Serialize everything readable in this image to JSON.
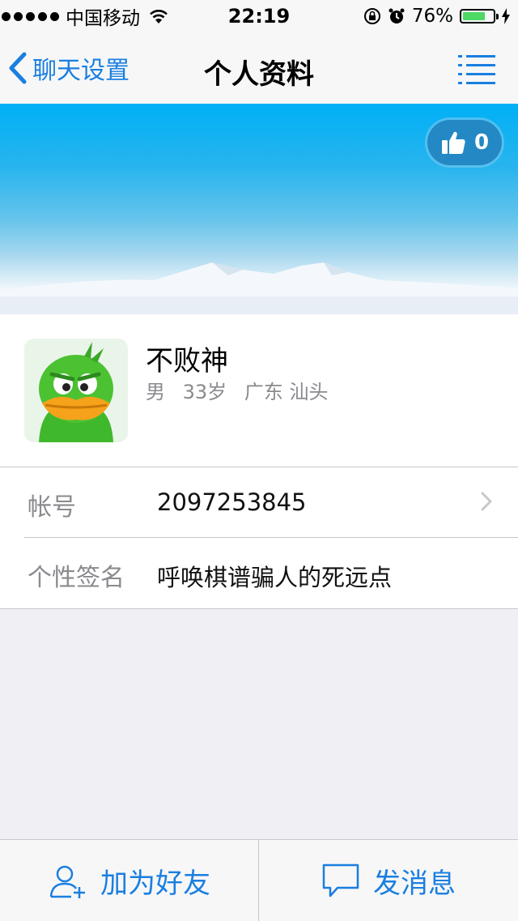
{
  "status_bar": {
    "carrier": "中国移动",
    "time": "22:19",
    "battery_percent": "76%",
    "battery_level": 0.76
  },
  "nav": {
    "back_label": "聊天设置",
    "title": "个人资料",
    "menu_icon": "list-menu-icon"
  },
  "banner": {
    "like_count": "0"
  },
  "profile": {
    "name": "不败神",
    "gender": "男",
    "age": "33岁",
    "location": "广东 汕头"
  },
  "details": [
    {
      "label": "帐号",
      "value": "2097253845"
    },
    {
      "label": "个性签名",
      "value": "呼唤棋谱骗人的死远点"
    }
  ],
  "actions": {
    "add_friend": "加为好友",
    "send_message": "发消息"
  },
  "colors": {
    "accent": "#1a7fe0",
    "battery": "#4cd964",
    "like_badge": "#2388c4"
  }
}
